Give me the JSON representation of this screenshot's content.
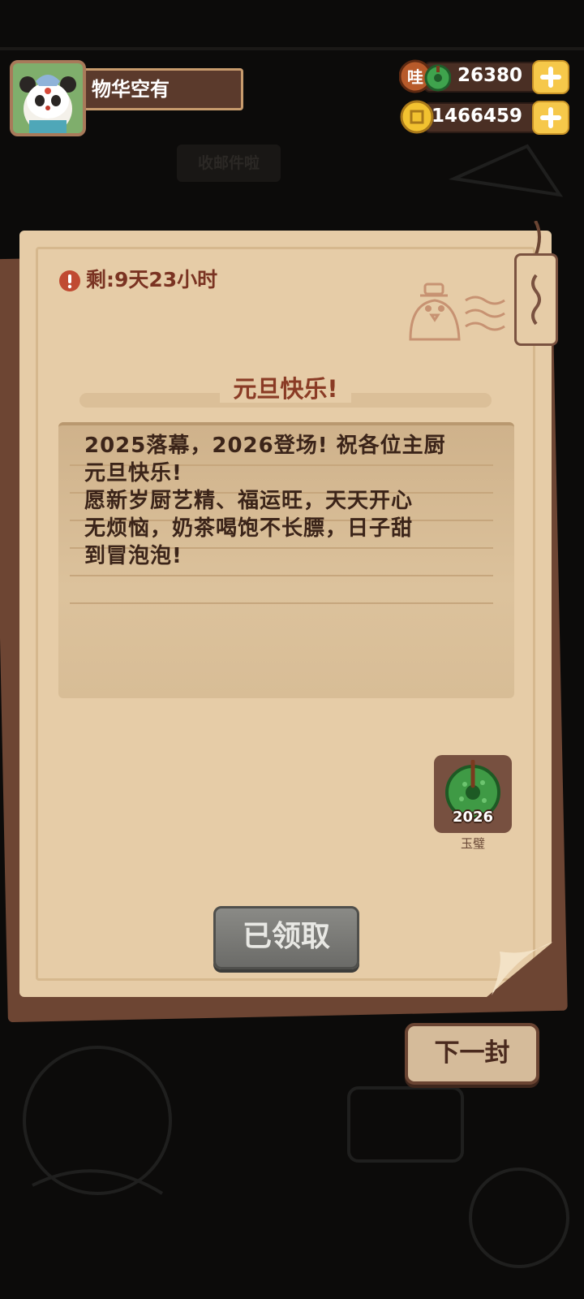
{
  "player": {
    "name": "物华空有"
  },
  "currencies": [
    {
      "icon": "jade-coin-icon",
      "badge": "哇",
      "value": "26380"
    },
    {
      "icon": "gold-coin-icon",
      "value": "1466459"
    }
  ],
  "background_tab": "收邮件啦",
  "letter": {
    "remaining": "剩:9天23小时",
    "title": "元旦快乐!",
    "body_lines": [
      "2025落幕，2026登场! 祝各位主厨",
      "元旦快乐!",
      "愿新岁厨艺精、福运旺，天天开心",
      "无烦恼，奶茶喝饱不长膘，日子甜",
      "到冒泡泡!"
    ],
    "reward": {
      "year": "2026",
      "name": "玉璧",
      "icon": "jade-bi-icon"
    },
    "claim_button": "已领取"
  },
  "next_button": "下一封",
  "colors": {
    "paper": "#e6cca7",
    "title": "#8a3b25",
    "text": "#3b2419",
    "accent_gold": "#f6c84a"
  }
}
